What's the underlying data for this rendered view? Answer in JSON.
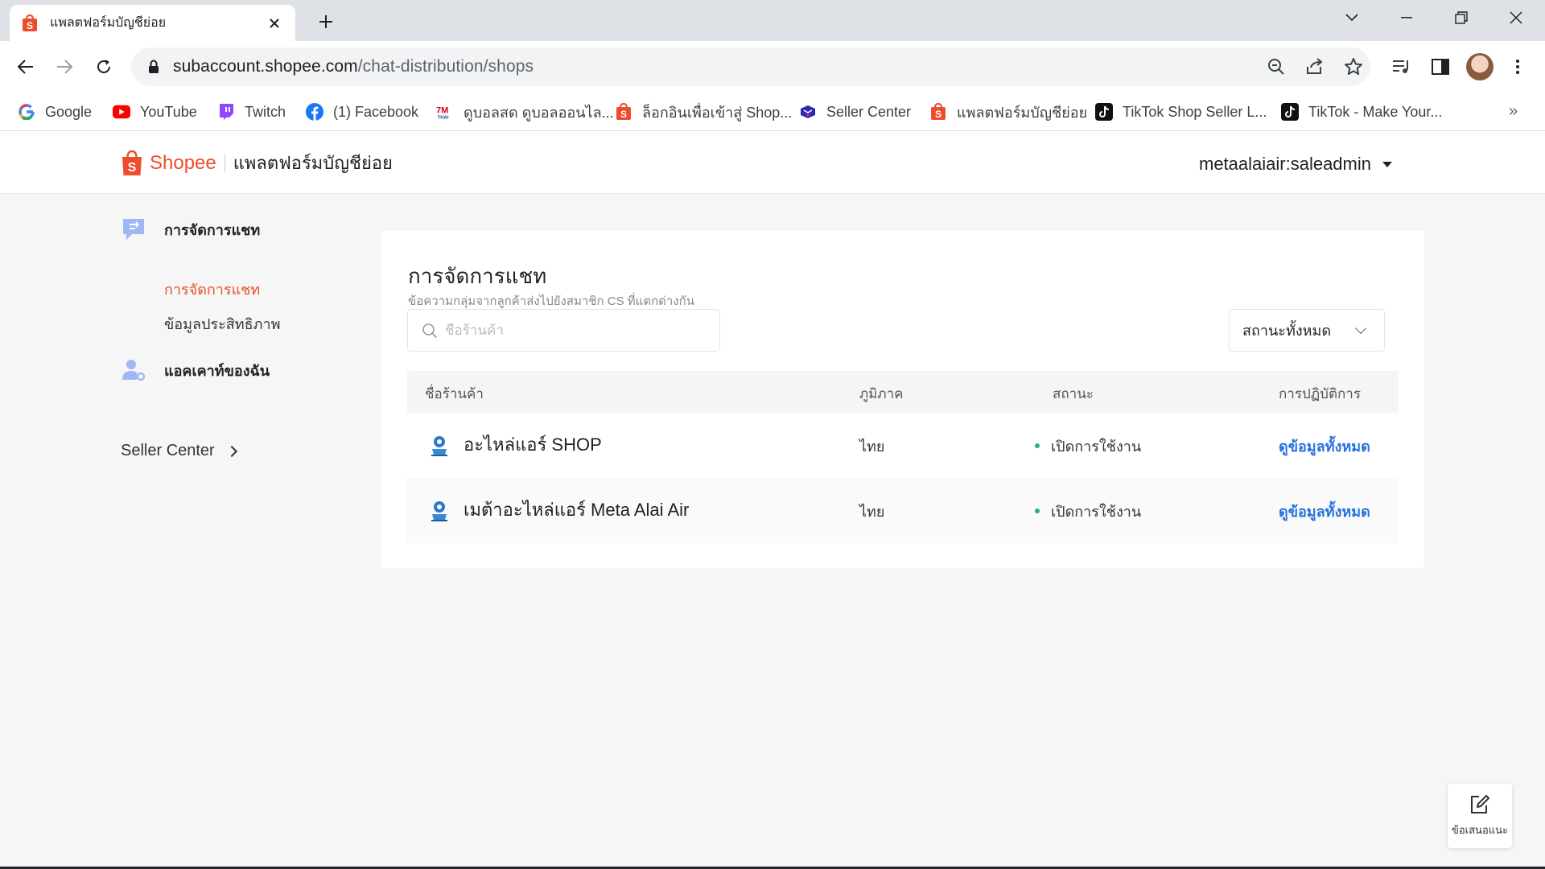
{
  "browser": {
    "tab_title": "แพลตฟอร์มบัญชีย่อย",
    "url_domain": "subaccount.shopee.com",
    "url_path": "/chat-distribution/shops",
    "bookmarks": [
      {
        "label": "Google",
        "icon": "google-icon"
      },
      {
        "label": "YouTube",
        "icon": "youtube-icon"
      },
      {
        "label": "Twitch",
        "icon": "twitch-icon"
      },
      {
        "label": "(1) Facebook",
        "icon": "facebook-icon"
      },
      {
        "label": "ดูบอลสด ดูบอลออนไล...",
        "icon": "7m-icon"
      },
      {
        "label": "ล็อกอินเพื่อเข้าสู่ Shop...",
        "icon": "shopee-icon"
      },
      {
        "label": "Seller Center",
        "icon": "seller-center-icon"
      },
      {
        "label": "แพลตฟอร์มบัญชีย่อย",
        "icon": "shopee-icon"
      },
      {
        "label": "TikTok Shop Seller L...",
        "icon": "tiktok-icon"
      },
      {
        "label": "TikTok - Make Your...",
        "icon": "tiktok-icon"
      }
    ],
    "more_bookmarks": "»"
  },
  "header": {
    "brand": "Shopee",
    "subtitle": "แพลตฟอร์มบัญชีย่อย",
    "account": "metaalaiair:saleadmin"
  },
  "sidebar": {
    "chat_group": "การจัดการแชท",
    "chat_items": [
      "การจัดการแชท",
      "ข้อมูลประสิทธิภาพ"
    ],
    "account_group": "แอคเคาท์ของฉัน",
    "seller_center": "Seller Center"
  },
  "main": {
    "title": "การจัดการแชท",
    "description": "ข้อความกลุ่มจากลูกค้าส่งไปยังสมาชิก CS ที่แตกต่างกัน",
    "search_placeholder": "ชื่อร้านค้า",
    "status_filter": "สถานะทั้งหมด",
    "columns": [
      "ชื่อร้านค้า",
      "ภูมิภาค",
      "สถานะ",
      "การปฏิบัติการ"
    ],
    "rows": [
      {
        "shop": "อะไหล่แอร์ SHOP",
        "region": "ไทย",
        "status": "เปิดการใช้งาน",
        "action": "ดูข้อมูลทั้งหมด"
      },
      {
        "shop": "เมต้าอะไหล่แอร์ Meta Alai Air",
        "region": "ไทย",
        "status": "เปิดการใช้งาน",
        "action": "ดูข้อมูลทั้งหมด"
      }
    ]
  },
  "feedback": {
    "label": "ข้อเสนอแนะ"
  },
  "colors": {
    "brand": "#ee4d2d",
    "link": "#2673dd",
    "status_active": "#26aa99"
  }
}
